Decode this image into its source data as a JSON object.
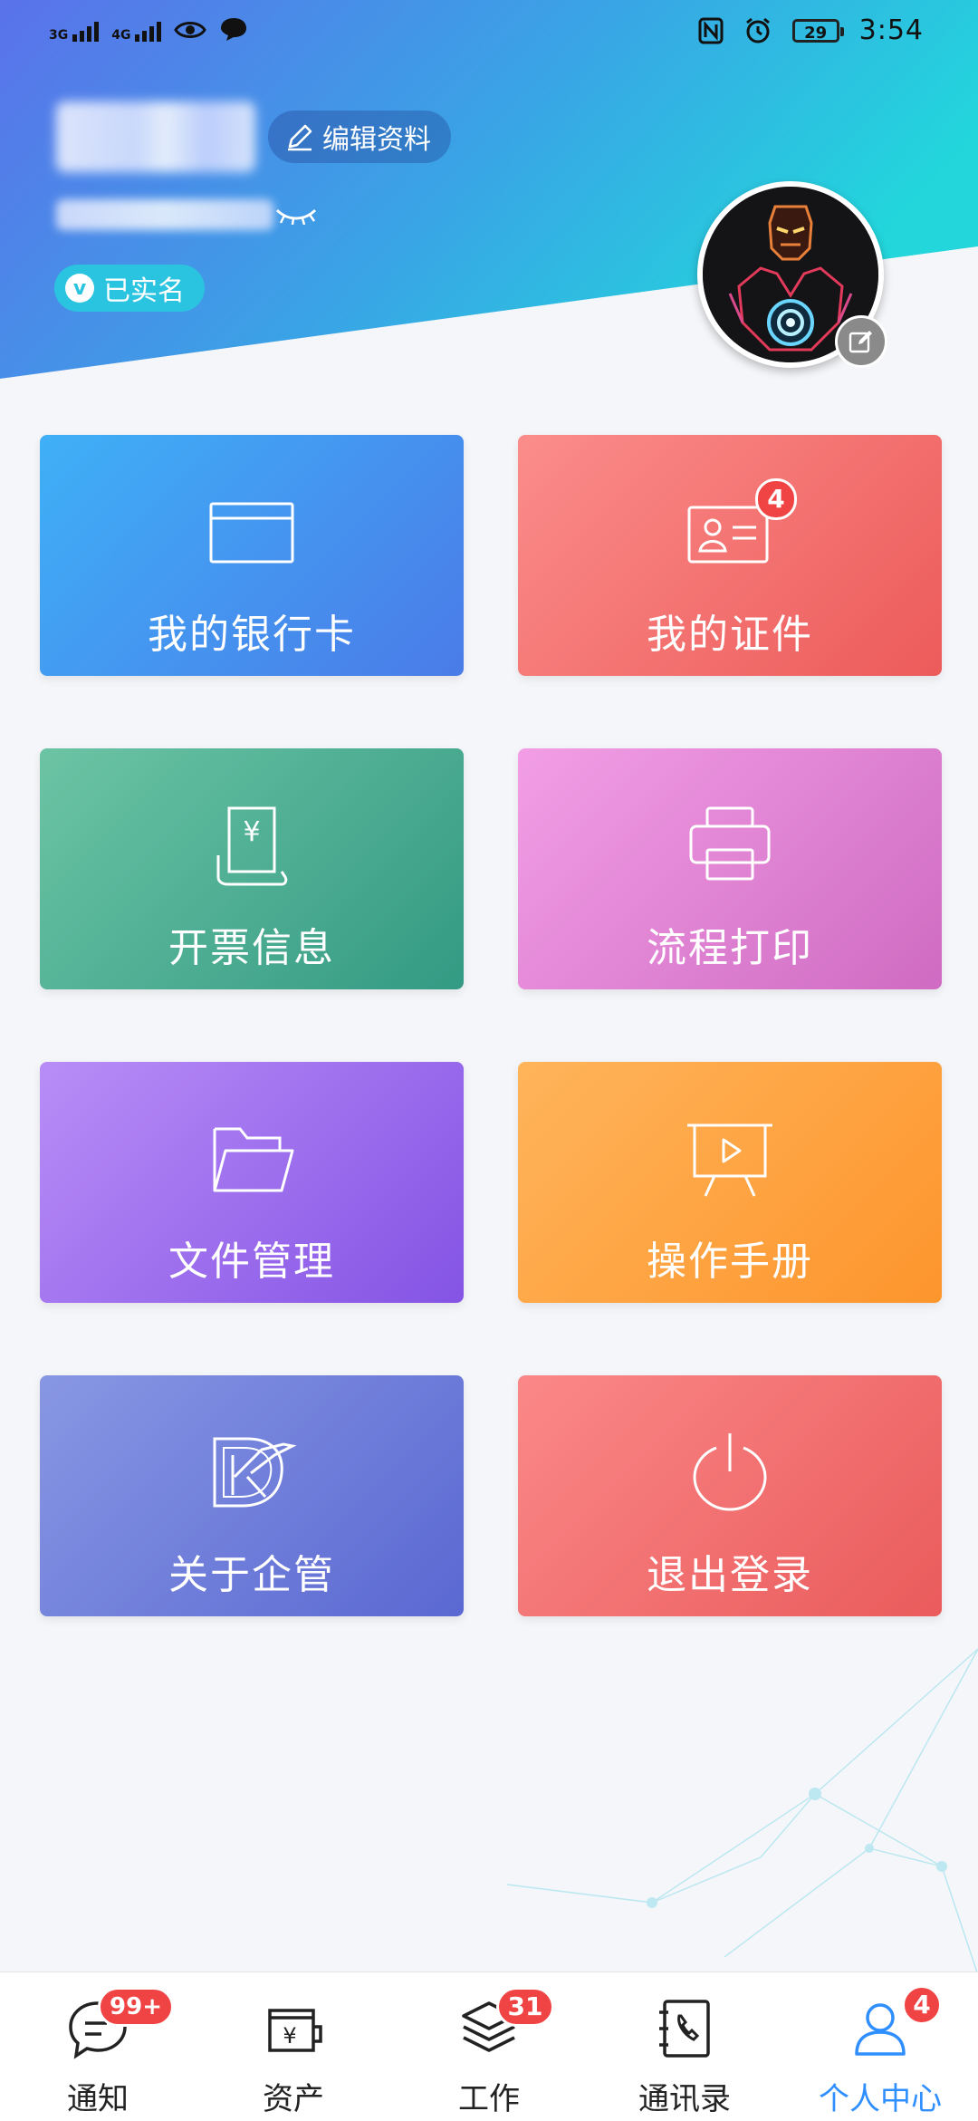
{
  "status_bar": {
    "net1": "3G",
    "net2": "4G",
    "battery": "29",
    "time": "3:54"
  },
  "profile": {
    "edit_label": "编辑资料",
    "verified_badge_letter": "v",
    "verified_label": "已实名"
  },
  "cards": [
    {
      "label": "我的银行卡",
      "icon": "bank-card-icon",
      "colors": [
        "#3fb0f7",
        "#4a7be8"
      ]
    },
    {
      "label": "我的证件",
      "icon": "id-card-icon",
      "badge": "4",
      "colors": [
        "#fb8d8b",
        "#ec5b5a"
      ]
    },
    {
      "label": "开票信息",
      "icon": "invoice-icon",
      "colors": [
        "#6cc4a4",
        "#339a83"
      ]
    },
    {
      "label": "流程打印",
      "icon": "printer-icon",
      "colors": [
        "#f29ee6",
        "#cf6bc2"
      ]
    },
    {
      "label": "文件管理",
      "icon": "folder-icon",
      "colors": [
        "#b98df7",
        "#8453e4"
      ]
    },
    {
      "label": "操作手册",
      "icon": "presentation-icon",
      "colors": [
        "#ffb45b",
        "#fd952c"
      ]
    },
    {
      "label": "关于企管",
      "icon": "company-logo-icon",
      "colors": [
        "#8897e3",
        "#5a68d2"
      ]
    },
    {
      "label": "退出登录",
      "icon": "power-icon",
      "colors": [
        "#fb8888",
        "#ea5b5c"
      ]
    }
  ],
  "bottom_nav": [
    {
      "label": "通知",
      "icon": "chat-bubble-icon",
      "badge": "99+"
    },
    {
      "label": "资产",
      "icon": "wallet-icon"
    },
    {
      "label": "工作",
      "icon": "layers-icon",
      "badge": "31"
    },
    {
      "label": "通讯录",
      "icon": "contacts-book-icon"
    },
    {
      "label": "个人中心",
      "icon": "person-icon",
      "badge": "4",
      "active": true
    }
  ],
  "accent_color": "#2f8fff",
  "badge_color": "#f04343"
}
